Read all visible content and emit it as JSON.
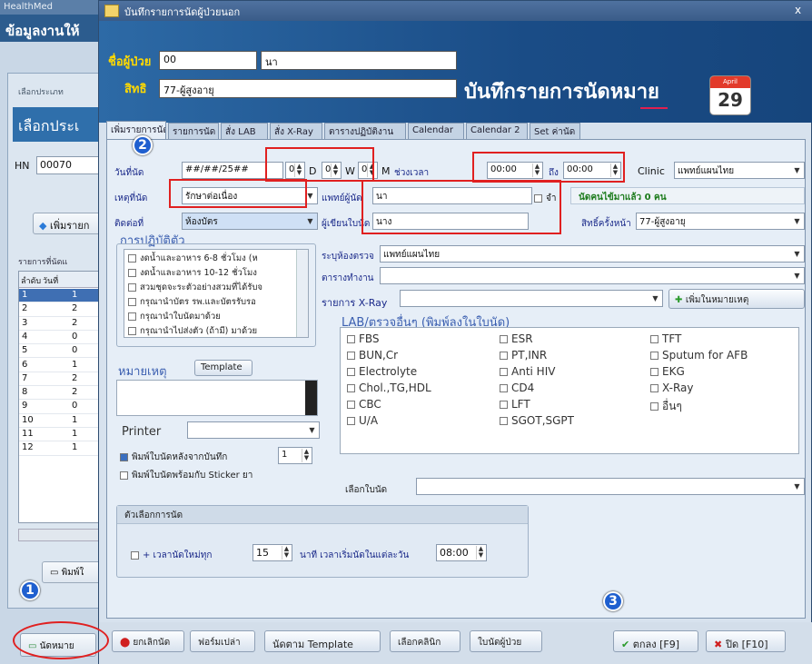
{
  "bg": {
    "titlebar": "HealthMed",
    "header": "ข้อมูลงานให้",
    "sub_label": "เลือกประเภท",
    "select_header": "เลือกประเ",
    "hn_label": "HN",
    "hn_value": "00070",
    "add_button": "เพิ่มรายก",
    "list_label": "รายการที่นัดแ",
    "col_order": "ลำดับ",
    "col_date": "วันที่",
    "rows": [
      {
        "n": "1",
        "d": "1"
      },
      {
        "n": "2",
        "d": "2"
      },
      {
        "n": "3",
        "d": "2"
      },
      {
        "n": "4",
        "d": "0"
      },
      {
        "n": "5",
        "d": "0"
      },
      {
        "n": "6",
        "d": "1"
      },
      {
        "n": "7",
        "d": "2"
      },
      {
        "n": "8",
        "d": "2"
      },
      {
        "n": "9",
        "d": "0"
      },
      {
        "n": "10",
        "d": "1"
      },
      {
        "n": "11",
        "d": "1"
      },
      {
        "n": "12",
        "d": "1"
      }
    ],
    "print_button": "พิมพ์ใ",
    "appoint_button": "นัดหมาย"
  },
  "dialog": {
    "title": "บันทึกรายการนัดผู้ป่วยนอก",
    "close": "x",
    "patient_label": "ชื่อผู้ป่วย",
    "hn_value": "00",
    "name_value": "นา",
    "right_label": "สิทธิ",
    "right_value": "77-ผู้สูงอายุ",
    "banner_title": "บันทึกรายการนัดหมาย",
    "calendar_month": "April",
    "calendar_day": "29"
  },
  "tabs": [
    "เพิ่มรายการนัด",
    "รายการนัด",
    "สั่ง LAB",
    "สั่ง X-Ray",
    "ตารางปฏิบัติงาน",
    "Calendar",
    "Calendar 2",
    "Set ค่านัด"
  ],
  "form": {
    "date_label": "วันที่นัด",
    "date_value": "##/##/25##",
    "d_value": "0",
    "d_label": "D",
    "w_value": "0",
    "w_label": "W",
    "m_value": "0",
    "m_label": "M",
    "time_label": "ช่วงเวลา",
    "time_from": "00:00",
    "to_label": "ถึง",
    "time_to": "00:00",
    "clinic_label": "Clinic",
    "clinic_value": "แพทย์แผนไทย",
    "reason_label": "เหตุที่นัด",
    "reason_value": "รักษาต่อเนื่อง",
    "doctor_label": "แพทย์ผู้นัด",
    "doctor_value": "นา",
    "doctor_check": "จำ",
    "appointed_count": "นัดคนไข้มาแล้ว 0 คน",
    "contact_label": "ติดต่อที่",
    "contact_value": "ห้องบัตร",
    "recorder_label": "ผู้เขียนใบนัด",
    "recorder_value": "นาง",
    "right_label": "สิทธิ์ครั้งหน้า",
    "right_value": "77-ผู้สูงอายุ",
    "room_label": "ระบุห้องตรวจ",
    "room_value": "แพทย์แผนไทย",
    "schedule_label": "ตารางทำงาน",
    "xray_label": "รายการ X-Ray",
    "add_note_button": "เพิ่มในหมายเหตุ",
    "practice_title": "การปฏิบัติตัว",
    "practice_items": [
      "งดน้ำและอาหาร 6-8 ชั่วโมง (ห",
      "งดน้ำและอาหาร 10-12 ชั่วโมง",
      "สวมชุดจะระตัวอย่างสวมที่ได้รับจ",
      "กรุณานำบัตร รพ.และบัตรรับรอ",
      "กรุณานำใบนัดมาด้วย",
      "กรุณานำไปส่งตัว (ถ้ามี) มาด้วย"
    ],
    "note_label": "หมายเหตุ",
    "template_button": "Template",
    "printer_label": "Printer",
    "print_after_save": "พิมพ์ใบนัดหลังจากบันทึก",
    "print_copies": "1",
    "print_sticker": "พิมพ์ใบนัดพร้อมกับ Sticker ยา",
    "lab_title": "LAB/ตรวจอื่นๆ (พิมพ์ลงในใบนัด)",
    "lab_col1": [
      "FBS",
      "BUN,Cr",
      "Electrolyte",
      "Chol.,TG,HDL",
      "CBC",
      "U/A"
    ],
    "lab_col2": [
      "ESR",
      "PT,INR",
      "Anti HIV",
      "CD4",
      "LFT",
      "SGOT,SGPT"
    ],
    "lab_col3": [
      "TFT",
      "Sputum for AFB",
      "EKG",
      "X-Ray",
      "อื่นๆ"
    ],
    "choose_label": "เลือกใบนัด",
    "options_title": "ตัวเลือกการนัด",
    "repeat_label": "+ เวลานัดใหม่ทุก",
    "repeat_value": "15",
    "minutes_label": "นาที เวลาเริ่มนัดในแต่ละวัน",
    "start_time": "08:00"
  },
  "footer": {
    "cancel": "ยกเลิกนัด",
    "blank_form": "ฟอร์มเปล่า",
    "by_template": "นัดตาม Template",
    "choose_clinic": "เลือกคลินิก",
    "appoint_slip": "ใบนัดผู้ป่วย",
    "ok": "ตกลง [F9]",
    "close": "ปิด [F10]"
  },
  "callouts": [
    "1",
    "2",
    "3"
  ],
  "colors": {
    "accent": "#1a4c86",
    "highlight": "#e02020",
    "label_yellow": "#ffd900"
  }
}
